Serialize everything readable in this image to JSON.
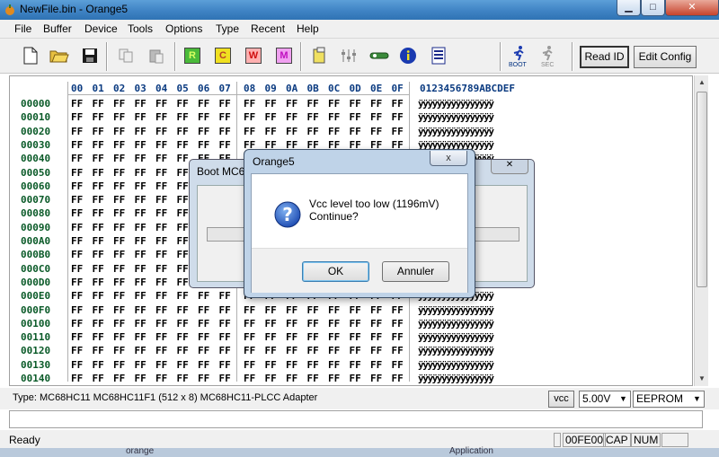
{
  "window": {
    "title": "NewFile.bin - Orange5"
  },
  "menu": [
    "File",
    "Buffer",
    "Device",
    "Tools",
    "Options",
    "Type",
    "Recent",
    "Help"
  ],
  "toolbar": {
    "read_id": "Read ID",
    "edit_config": "Edit Config",
    "boot_label": "BOOT",
    "sec_label": "SEC",
    "icons": [
      "new-file-icon",
      "open-folder-icon",
      "save-icon",
      "copy-icon",
      "paste-icon",
      "read-icon",
      "check-icon",
      "write-icon",
      "module-icon",
      "clipboard-icon",
      "tune-icon",
      "settings-icon",
      "info-icon",
      "calculator-icon",
      "boot-runner-icon",
      "sec-runner-icon"
    ],
    "chip_letters": [
      "R",
      "C",
      "W",
      "M"
    ],
    "chip_colors": [
      "#1a8a1a",
      "#c8a000",
      "#d01010",
      "#c010c0"
    ]
  },
  "hex": {
    "columns": [
      "00",
      "01",
      "02",
      "03",
      "04",
      "05",
      "06",
      "07",
      "08",
      "09",
      "0A",
      "0B",
      "0C",
      "0D",
      "0E",
      "0F"
    ],
    "ascii_header": "0123456789ABCDEF",
    "addresses": [
      "00000",
      "00010",
      "00020",
      "00030",
      "00040",
      "00050",
      "00060",
      "00070",
      "00080",
      "00090",
      "000A0",
      "000B0",
      "000C0",
      "000D0",
      "000E0",
      "000F0",
      "00100",
      "00110",
      "00120",
      "00130",
      "00140"
    ],
    "byte_value": "FF",
    "ascii_row": "ÿÿÿÿÿÿÿÿÿÿÿÿÿÿÿÿ"
  },
  "device": {
    "type_text": "Type: MC68HC11 MC68HC11F1 (512 x 8)   MC68HC11-PLCC Adapter",
    "vcc_button": "vcc",
    "vcc_value": "5.00V",
    "memory": "EEPROM"
  },
  "status": {
    "ready": "Ready",
    "address": "00FE00",
    "cap": "CAP",
    "num": "NUM"
  },
  "background_dialog": {
    "title": "Boot MC6"
  },
  "dialog": {
    "title": "Orange5",
    "message_line1": "Vcc level too low (1196mV)",
    "message_line2": "Continue?",
    "ok": "OK",
    "cancel": "Annuler",
    "close": "x"
  },
  "taskbar": {
    "item1": "orange",
    "item2": "Application"
  }
}
